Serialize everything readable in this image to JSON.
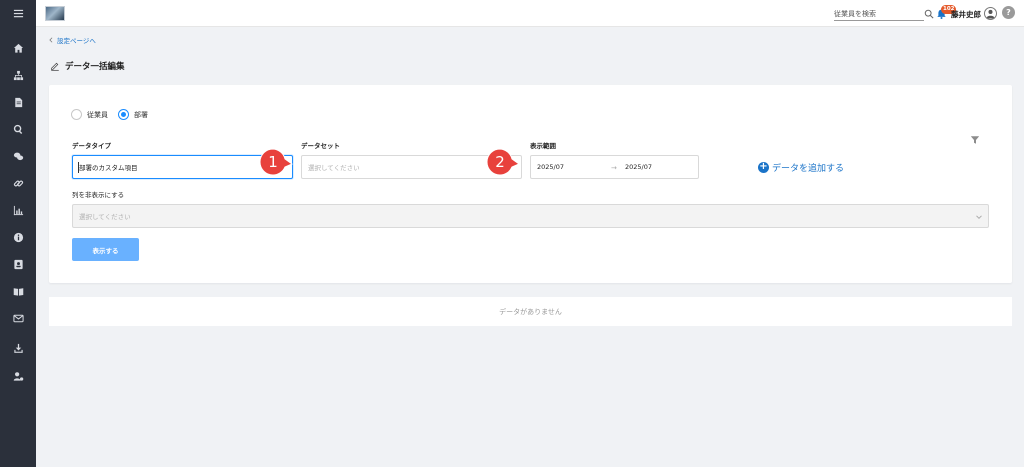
{
  "header": {
    "search_placeholder": "従業員を検索",
    "notification_count": "102",
    "user_name": "藤井史郎",
    "help_label": "?"
  },
  "breadcrumb": {
    "back_label": "設定ページへ"
  },
  "page": {
    "title": "データ一括編集"
  },
  "filter": {
    "radio_options": [
      {
        "label": "従業員",
        "selected": false
      },
      {
        "label": "部署",
        "selected": true
      }
    ],
    "data_type": {
      "label": "データタイプ",
      "value": "部署のカスタム項目"
    },
    "dataset": {
      "label": "データセット",
      "placeholder": "選択してください"
    },
    "display_range": {
      "label": "表示範囲",
      "start": "2025/07",
      "arrow": "→",
      "end": "2025/07"
    },
    "add_data_label": "データを追加する",
    "hide_columns": {
      "label": "列を非表示にする",
      "placeholder": "選択してください"
    },
    "show_button": "表示する"
  },
  "result": {
    "empty_message": "データがありません"
  },
  "annotations": [
    {
      "number": "1"
    },
    {
      "number": "2"
    }
  ],
  "colors": {
    "accent": "#1a8cff",
    "link": "#1a73c8",
    "sidebar": "#2b303b",
    "marker": "#e8413c"
  },
  "sidebar_icons": [
    "home-icon",
    "org-chart-icon",
    "document-icon",
    "search-icon",
    "chat-icon",
    "link-icon",
    "chart-icon",
    "info-icon",
    "contact-card-icon",
    "book-icon",
    "mail-icon",
    "download-icon",
    "user-settings-icon"
  ]
}
